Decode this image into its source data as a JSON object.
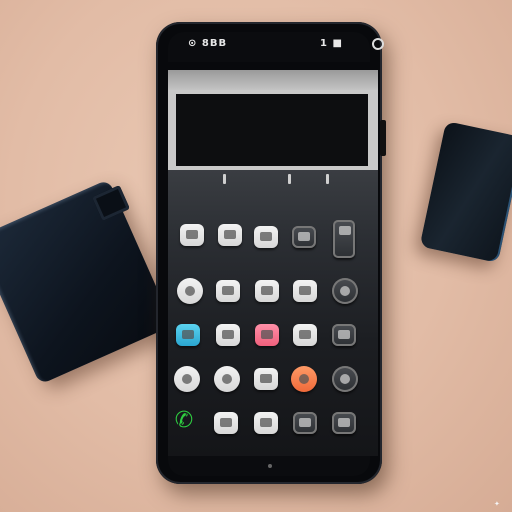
{
  "status_bar": {
    "left_text": "⊙ 8BB",
    "right_text": "1 ■"
  },
  "icons": {
    "phone": "phone-call-icon",
    "camera": "front-camera-icon"
  },
  "colors": {
    "background": "#e2bca6",
    "phone_body": "#08090c",
    "key_cyan": "#2aa6d0",
    "key_pink": "#f0607c",
    "key_orange": "#f06a3a",
    "call_green": "#2ecc40"
  }
}
